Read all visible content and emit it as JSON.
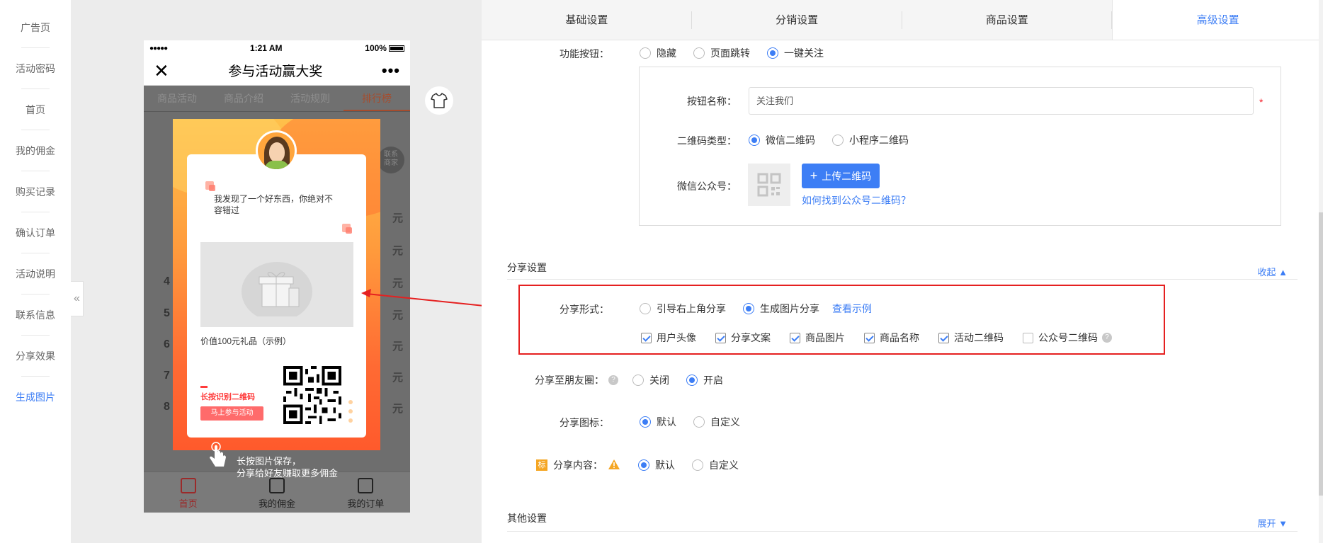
{
  "leftnav": {
    "items": [
      {
        "label": "广告页"
      },
      {
        "label": "活动密码"
      },
      {
        "label": "首页"
      },
      {
        "label": "我的佣金"
      },
      {
        "label": "购买记录"
      },
      {
        "label": "确认订单"
      },
      {
        "label": "活动说明"
      },
      {
        "label": "联系信息"
      },
      {
        "label": "分享效果"
      },
      {
        "label": "生成图片"
      }
    ]
  },
  "collapse_glyph": "«",
  "phone": {
    "status": {
      "signal": "●●●●●",
      "time": "1:21 AM",
      "battery": "100%"
    },
    "nav": {
      "close": "✕",
      "title": "参与活动赢大奖",
      "more": "•••"
    },
    "tabs": [
      "商品活动",
      "商品介绍",
      "活动规则",
      "排行榜"
    ],
    "contact": "联系\n商家",
    "rank_rows": [
      {
        "rank": "",
        "amount": ""
      },
      {
        "rank": "",
        "amount": "元"
      },
      {
        "rank": "",
        "amount": "元"
      },
      {
        "rank": "4",
        "amount": "元"
      },
      {
        "rank": "5",
        "amount": "元"
      },
      {
        "rank": "6",
        "amount": "元"
      },
      {
        "rank": "7",
        "amount": "元"
      },
      {
        "rank": "8",
        "amount": "元"
      }
    ],
    "tabbar": [
      {
        "label": "首页"
      },
      {
        "label": "我的佣金"
      },
      {
        "label": "我的订单"
      }
    ]
  },
  "poster": {
    "slogan_line1": "我发现了一个好东西，你绝对不",
    "slogan_line2": "容错过",
    "gift_label": "价值100元礼品（示例）",
    "longpress_label": "长按识别二维码",
    "join_button": "马上参与活动",
    "hint_line1": "长按图片保存，",
    "hint_line2": "分享给好友赚取更多佣金"
  },
  "settings": {
    "tabs": [
      "基础设置",
      "分销设置",
      "商品设置",
      "高级设置"
    ],
    "function_button": {
      "label": "功能按钮：",
      "options": [
        "隐藏",
        "页面跳转",
        "一键关注"
      ],
      "selected": 2
    },
    "button_name": {
      "label": "按钮名称：",
      "value": "关注我们",
      "required": "*"
    },
    "qr_type": {
      "label": "二维码类型：",
      "options": [
        "微信二维码",
        "小程序二维码"
      ],
      "selected": 0
    },
    "wechat_account": {
      "label": "微信公众号：",
      "upload_button": "上传二维码",
      "upload_icon": "+",
      "help_link": "如何找到公众号二维码？"
    },
    "share_section": {
      "title": "分享设置",
      "toggle": "收起",
      "form": {
        "label": "分享形式：",
        "options": [
          "引导右上角分享",
          "生成图片分享"
        ],
        "selected": 1,
        "example_link": "查看示例"
      },
      "fields": [
        {
          "label": "用户头像",
          "checked": true
        },
        {
          "label": "分享文案",
          "checked": true
        },
        {
          "label": "商品图片",
          "checked": true
        },
        {
          "label": "商品名称",
          "checked": true
        },
        {
          "label": "活动二维码",
          "checked": true
        },
        {
          "label": "公众号二维码",
          "checked": false
        }
      ],
      "moments": {
        "label": "分享至朋友圈：",
        "options": [
          "关闭",
          "开启"
        ],
        "selected": 1
      },
      "icon": {
        "label": "分享图标：",
        "options": [
          "默认",
          "自定义"
        ],
        "selected": 0
      },
      "content": {
        "label": "分享内容：",
        "badge": "标",
        "options": [
          "默认",
          "自定义"
        ],
        "selected": 0
      }
    },
    "other_section": {
      "title": "其他设置",
      "toggle": "展开"
    }
  },
  "colors": {
    "accent": "#3d7ef5",
    "highlight": "#e52020",
    "poster": "#ff8a3c"
  }
}
